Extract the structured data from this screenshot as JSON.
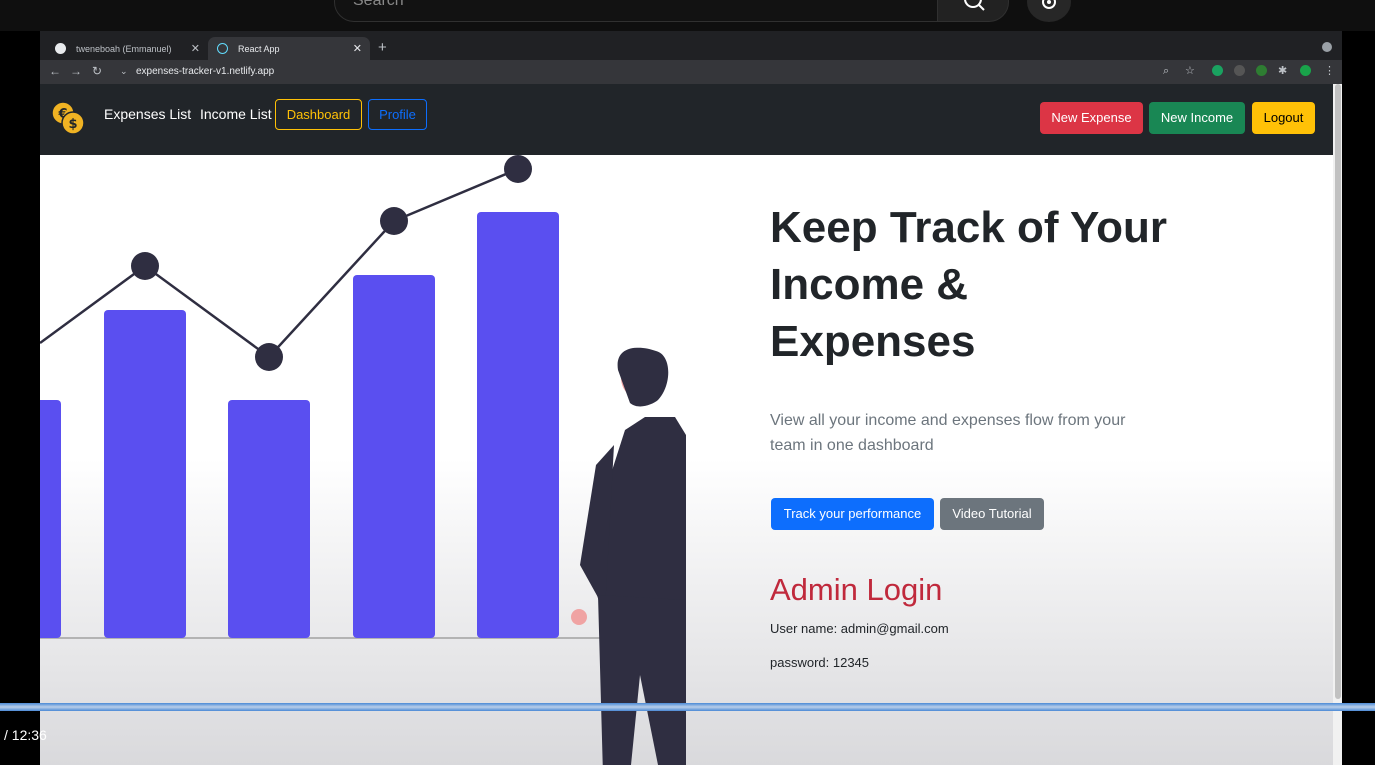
{
  "youtube": {
    "search_placeholder": "Search",
    "time": "/ 12:36",
    "progress_pct": 100
  },
  "browser": {
    "tabs": [
      {
        "label": "tweneboah (Emmanuel)",
        "active": false
      },
      {
        "label": "React App",
        "active": true
      }
    ],
    "url": "expenses-tracker-v1.netlify.app"
  },
  "navbar": {
    "links": [
      "Expenses List",
      "Income List"
    ],
    "dashboard_label": "Dashboard",
    "profile_label": "Profile",
    "new_expense_label": "New Expense",
    "new_income_label": "New Income",
    "logout_label": "Logout"
  },
  "hero": {
    "title": "Keep Track of Your Income & Expenses",
    "lead": "View all your income and expenses flow from your team in one dashboard",
    "track_label": "Track your performance",
    "video_label": "Video Tutorial"
  },
  "admin": {
    "heading": "Admin Login",
    "username": "User name: admin@gmail.com",
    "password": "password: 12345"
  },
  "colors": {
    "bar": "#5a4ff0",
    "accent_red": "#c0293c",
    "navbar_bg": "#212529"
  }
}
